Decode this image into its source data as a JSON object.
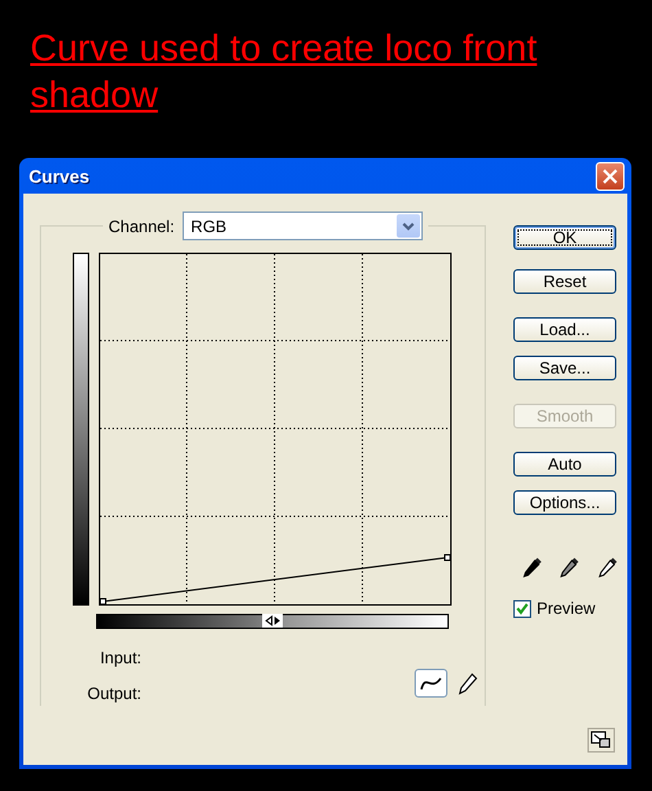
{
  "heading": "Curve used to create loco front shadow",
  "window": {
    "title": "Curves"
  },
  "channel": {
    "label": "Channel:",
    "value": "RGB"
  },
  "buttons": [
    {
      "label": "OK",
      "disabled": false,
      "default": true
    },
    {
      "label": "Reset",
      "disabled": false,
      "default": false
    },
    {
      "label": "Load...",
      "disabled": false,
      "default": false
    },
    {
      "label": "Save...",
      "disabled": false,
      "default": false
    },
    {
      "label": "Smooth",
      "disabled": true,
      "default": false
    },
    {
      "label": "Auto",
      "disabled": false,
      "default": false
    },
    {
      "label": "Options...",
      "disabled": false,
      "default": false
    }
  ],
  "preview": {
    "label": "Preview",
    "checked": true
  },
  "readouts": [
    {
      "label": "Input:"
    },
    {
      "label": "Output:"
    }
  ],
  "tools": [
    {
      "kind": "curve",
      "selected": true
    },
    {
      "kind": "pencil",
      "selected": false
    }
  ]
}
